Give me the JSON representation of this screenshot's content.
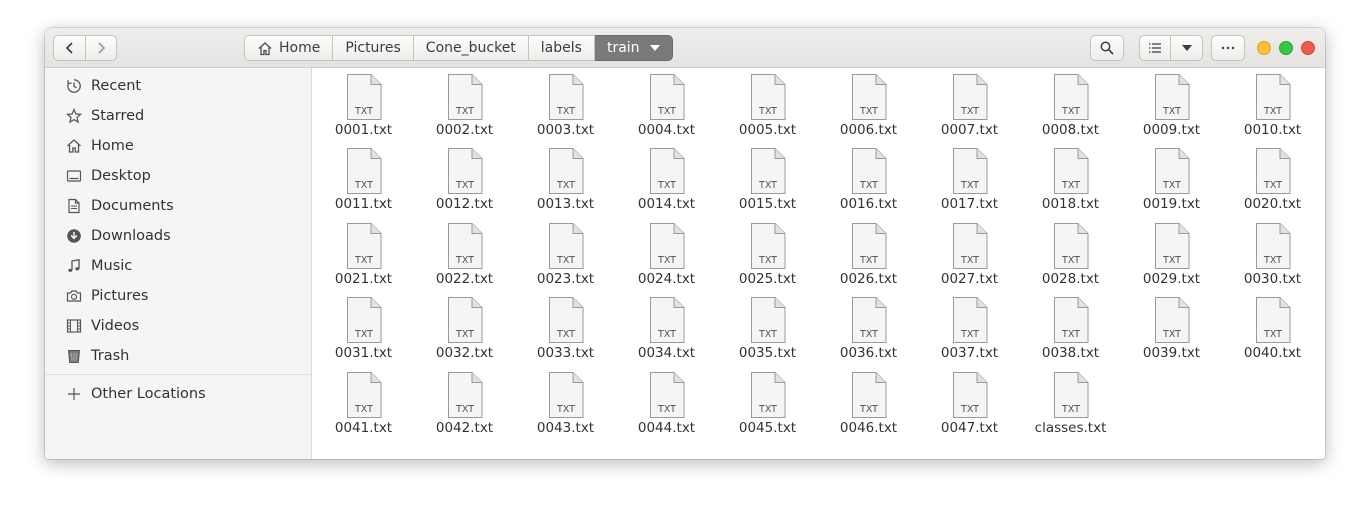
{
  "breadcrumbs": [
    "Home",
    "Pictures",
    "Cone_bucket",
    "labels",
    "train"
  ],
  "sidebar": {
    "items": [
      {
        "label": "Recent",
        "icon": "clock-icon"
      },
      {
        "label": "Starred",
        "icon": "star-icon"
      },
      {
        "label": "Home",
        "icon": "home-icon"
      },
      {
        "label": "Desktop",
        "icon": "desktop-icon"
      },
      {
        "label": "Documents",
        "icon": "document-icon"
      },
      {
        "label": "Downloads",
        "icon": "download-icon"
      },
      {
        "label": "Music",
        "icon": "music-icon"
      },
      {
        "label": "Pictures",
        "icon": "camera-icon"
      },
      {
        "label": "Videos",
        "icon": "film-icon"
      },
      {
        "label": "Trash",
        "icon": "trash-icon"
      }
    ],
    "other_locations": "Other Locations"
  },
  "file_type_badge": "TXT",
  "files": [
    "0001.txt",
    "0002.txt",
    "0003.txt",
    "0004.txt",
    "0005.txt",
    "0006.txt",
    "0007.txt",
    "0008.txt",
    "0009.txt",
    "0010.txt",
    "0011.txt",
    "0012.txt",
    "0013.txt",
    "0014.txt",
    "0015.txt",
    "0016.txt",
    "0017.txt",
    "0018.txt",
    "0019.txt",
    "0020.txt",
    "0021.txt",
    "0022.txt",
    "0023.txt",
    "0024.txt",
    "0025.txt",
    "0026.txt",
    "0027.txt",
    "0028.txt",
    "0029.txt",
    "0030.txt",
    "0031.txt",
    "0032.txt",
    "0033.txt",
    "0034.txt",
    "0035.txt",
    "0036.txt",
    "0037.txt",
    "0038.txt",
    "0039.txt",
    "0040.txt",
    "0041.txt",
    "0042.txt",
    "0043.txt",
    "0044.txt",
    "0045.txt",
    "0046.txt",
    "0047.txt",
    "classes.txt"
  ],
  "colors": {
    "active_crumb": "#7a7a78",
    "close": "#ee5b4f",
    "maximize": "#3ec24a",
    "minimize": "#f6c23b"
  }
}
